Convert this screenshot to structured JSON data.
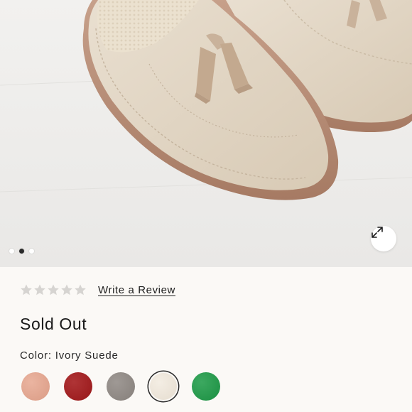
{
  "gallery": {
    "image_alt": "Ivory suede tassel loafers",
    "dots": [
      {
        "active": false
      },
      {
        "active": true
      },
      {
        "active": false
      }
    ],
    "expand_icon": "expand-arrows-icon"
  },
  "rating": {
    "stars_filled": 0,
    "stars_total": 5,
    "write_review_label": "Write a Review"
  },
  "availability": {
    "status_label": "Sold Out"
  },
  "color": {
    "label": "Color: Ivory Suede",
    "swatches": [
      {
        "name": "blush",
        "hex": "#e6a48c"
      },
      {
        "name": "red",
        "hex": "#a4181a"
      },
      {
        "name": "grey",
        "hex": "#8e8782"
      },
      {
        "name": "ivory suede",
        "hex": "#efe6d8",
        "selected": true
      },
      {
        "name": "green",
        "hex": "#1c9a46"
      }
    ]
  }
}
